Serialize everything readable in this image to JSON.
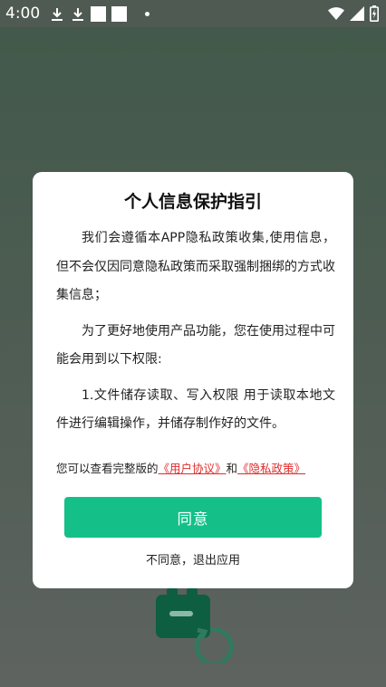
{
  "status_bar": {
    "time": "4:00",
    "icons_left": [
      "download-icon",
      "download-icon",
      "square-icon",
      "square-icon",
      "dot-icon"
    ],
    "icons_right": [
      "wifi-icon",
      "signal-icon",
      "battery-charging-icon"
    ]
  },
  "dialog": {
    "title": "个人信息保护指引",
    "paragraphs": [
      "我们会遵循本APP隐私政策收集,使用信息，但不会仅因同意隐私政策而采取强制捆绑的方式收集信息；",
      "为了更好地使用产品功能，您在使用过程中可能会用到以下权限:",
      "1.文件储存读取、写入权限 用于读取本地文件进行编辑操作，并储存制作好的文件。"
    ],
    "links_prefix": "您可以查看完整版的",
    "user_agreement": "《用户协议》",
    "links_joiner": "和",
    "privacy_policy": "《隐私政策》",
    "agree_label": "同意",
    "disagree_label": "不同意，退出应用"
  },
  "colors": {
    "accent": "#15c088",
    "link": "#e02d2d",
    "overlay_top": "#41594a",
    "overlay_bottom": "#5e6360"
  }
}
